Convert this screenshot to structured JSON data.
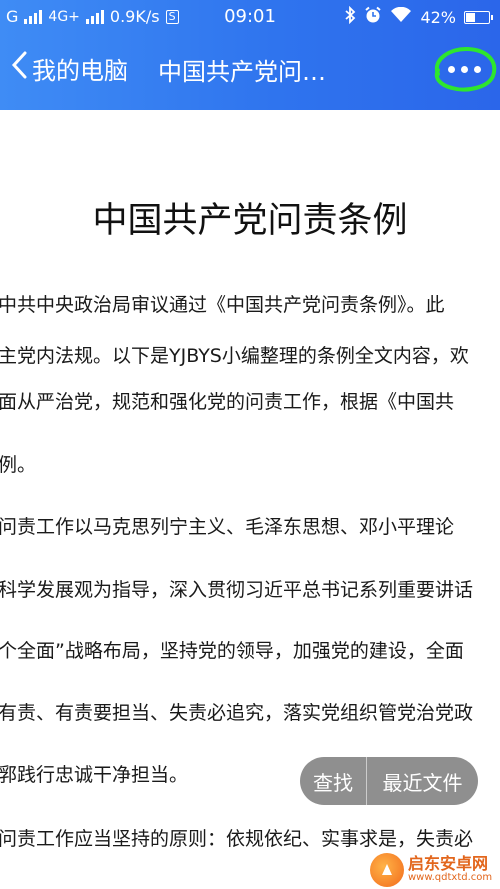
{
  "status_bar": {
    "carrier": "G",
    "network": "4G+",
    "speed": "0.9K/s",
    "speed_icon_letter": "S",
    "time": "09:01",
    "battery": "42%",
    "battery_level": 0.42
  },
  "nav": {
    "back_label": "我的电脑",
    "title": "中国共产党问…",
    "more_icon": "more-dots-icon"
  },
  "doc": {
    "title": "中国共产党问责条例",
    "lines": [
      "中共中央政治局审议通过《中国共产党问责条例》。此",
      "主党内法规。以下是YJBYS小编整理的条例全文内容，欢",
      "面从严治党，规范和强化党的问责工作，根据《中国共",
      "例。",
      "问责工作以马克思列宁主义、毛泽东思想、邓小平理论",
      "科学发展观为指导，深入贯彻习近平总书记系列重要讲话",
      "个全面”战略布局，坚持党的领导，加强党的建设，全面",
      "有责、有责要担当、失责必追究，落实党组织管党治党政",
      "郛践行忠诚干净担当。",
      "问责工作应当坚持的原则：依规依纪、实事求是，失责必"
    ]
  },
  "floating_actions": {
    "find_label": "查找",
    "recent_label": "最近文件"
  },
  "watermark": {
    "main": "启东安卓网",
    "url": "www.qdtxtd.com"
  },
  "colors": {
    "nav_gradient_start": "#3f8cf5",
    "nav_gradient_end": "#2b66ea",
    "annotation_circle": "#2ee62e",
    "pill_bg": "#767676"
  }
}
